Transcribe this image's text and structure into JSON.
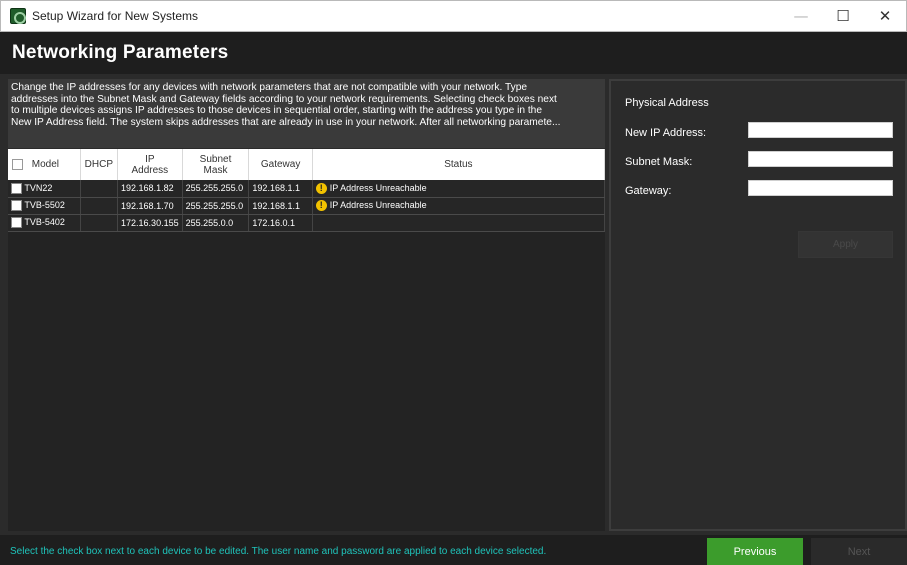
{
  "window": {
    "title": "Setup Wizard for New Systems",
    "app_icon": "app-logo-icon",
    "controls": {
      "minimize": "—",
      "maximize": "☐",
      "close": "✕"
    }
  },
  "header": {
    "title": "Networking Parameters"
  },
  "description": {
    "lines": [
      "Change the IP addresses for any devices with network parameters that are not compatible with your network. Type",
      "addresses into the Subnet Mask and Gateway fields according to your network requirements. Selecting check boxes next",
      "to multiple devices assigns IP addresses to those devices in sequential order, starting with the address you type in the",
      "New IP Address field. The system skips addresses that are already in use in your network. After all networking paramete..."
    ]
  },
  "table": {
    "columns": {
      "model": "Model",
      "dhcp": "DHCP",
      "ip_line1": "IP",
      "ip_line2": "Address",
      "subnet_line1": "Subnet",
      "subnet_line2": "Mask",
      "gateway": "Gateway",
      "status": "Status"
    },
    "rows": [
      {
        "model": "TVN22",
        "dhcp": "",
        "ip": "192.168.1.82",
        "subnet": "255.255.255.0",
        "gateway": "192.168.1.1",
        "status": "IP Address Unreachable",
        "warn": "!"
      },
      {
        "model": "TVB-5502",
        "dhcp": "",
        "ip": "192.168.1.70",
        "subnet": "255.255.255.0",
        "gateway": "192.168.1.1",
        "status": "IP Address Unreachable",
        "warn": "!"
      },
      {
        "model": "TVB-5402",
        "dhcp": "",
        "ip": "172.16.30.155",
        "subnet": "255.255.0.0",
        "gateway": "172.16.0.1",
        "status": "",
        "warn": ""
      }
    ]
  },
  "right_panel": {
    "physical_address_label": "Physical Address",
    "new_ip_label": "New IP Address:",
    "new_ip_value": "",
    "subnet_label": "Subnet Mask:",
    "subnet_value": "",
    "gateway_label": "Gateway:",
    "gateway_value": "",
    "apply_label": "Apply"
  },
  "footer": {
    "hint": "Select the check box next to each device to be edited. The user name and password are applied to each device selected.",
    "previous_label": "Previous",
    "next_label": "Next"
  },
  "colors": {
    "accent_green": "#3c9c2c",
    "hint_teal": "#1fc3ba",
    "warning_yellow": "#f2c200"
  }
}
